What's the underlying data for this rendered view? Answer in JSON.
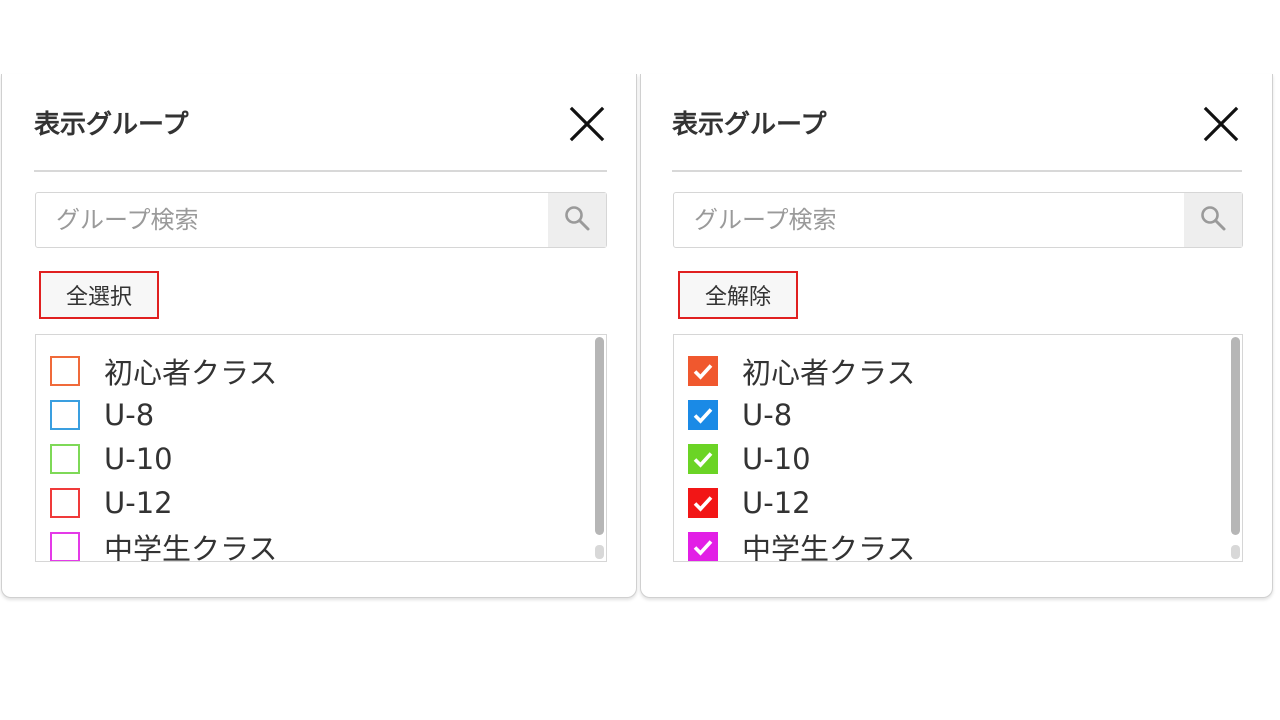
{
  "left_panel": {
    "title": "表示グループ",
    "search_placeholder": "グループ検索",
    "action_label": "全選択",
    "items": [
      {
        "label": "初心者クラス",
        "color": "#f06a3a",
        "checked": false
      },
      {
        "label": "U-8",
        "color": "#3a9fe0",
        "checked": false
      },
      {
        "label": "U-10",
        "color": "#7ed957",
        "checked": false
      },
      {
        "label": "U-12",
        "color": "#f03a3a",
        "checked": false
      },
      {
        "label": "中学生クラス",
        "color": "#e43ae8",
        "checked": false
      }
    ]
  },
  "right_panel": {
    "title": "表示グループ",
    "search_placeholder": "グループ検索",
    "action_label": "全解除",
    "items": [
      {
        "label": "初心者クラス",
        "color": "#f0582e",
        "checked": true
      },
      {
        "label": "U-8",
        "color": "#1a8ae6",
        "checked": true
      },
      {
        "label": "U-10",
        "color": "#6bd425",
        "checked": true
      },
      {
        "label": "U-12",
        "color": "#f21616",
        "checked": true
      },
      {
        "label": "中学生クラス",
        "color": "#e21fe6",
        "checked": true
      }
    ]
  },
  "icons": {
    "close": "close-icon",
    "search": "search-icon",
    "check": "check-icon"
  }
}
